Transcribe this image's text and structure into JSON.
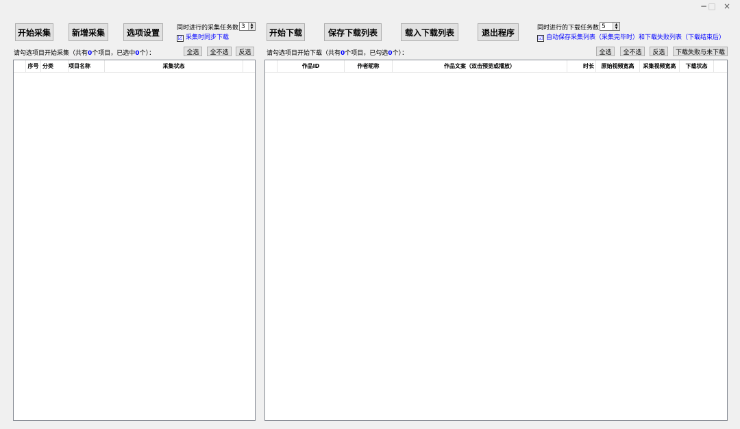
{
  "window": {
    "minimize_glyph": "−",
    "maximize_glyph": "□",
    "close_glyph": "×"
  },
  "collect": {
    "start_label": "开始采集",
    "add_label": "新增采集",
    "options_label": "选项设置",
    "concurrent_label": "同时进行的采集任务数",
    "concurrent_value": "3",
    "sync_download_label": "采集时同步下载",
    "sync_download_checked": "☑",
    "hint_prefix": "请勾选项目开始采集（共有",
    "total": "0",
    "hint_middle": "个项目，已选中",
    "selected": "0",
    "hint_suffix": "个）：",
    "select_all": "全选",
    "select_none": "全不选",
    "invert": "反选",
    "columns": [
      "序号",
      "分类",
      "项目名称",
      "采集状态"
    ]
  },
  "download": {
    "start_label": "开始下载",
    "save_list_label": "保存下载列表",
    "load_list_label": "载入下载列表",
    "exit_label": "退出程序",
    "concurrent_label": "同时进行的下载任务数",
    "concurrent_value": "5",
    "auto_save_label": "自动保存采集列表（采集完毕时）和下载失败列表（下载结束后）",
    "auto_save_checked": "☑",
    "hint_prefix": "请勾选项目开始下载（共有",
    "total": "0",
    "hint_middle": "个项目，已勾选",
    "selected": "0",
    "hint_suffix": "个）：",
    "select_all": "全选",
    "select_none": "全不选",
    "invert": "反选",
    "failed_undownloaded": "下载失败与未下载",
    "columns": [
      "作品ID",
      "作者昵称",
      "作品文案（双击预览或播放）",
      "时长",
      "原始视频宽高",
      "采集视频宽高",
      "下载状态"
    ]
  }
}
